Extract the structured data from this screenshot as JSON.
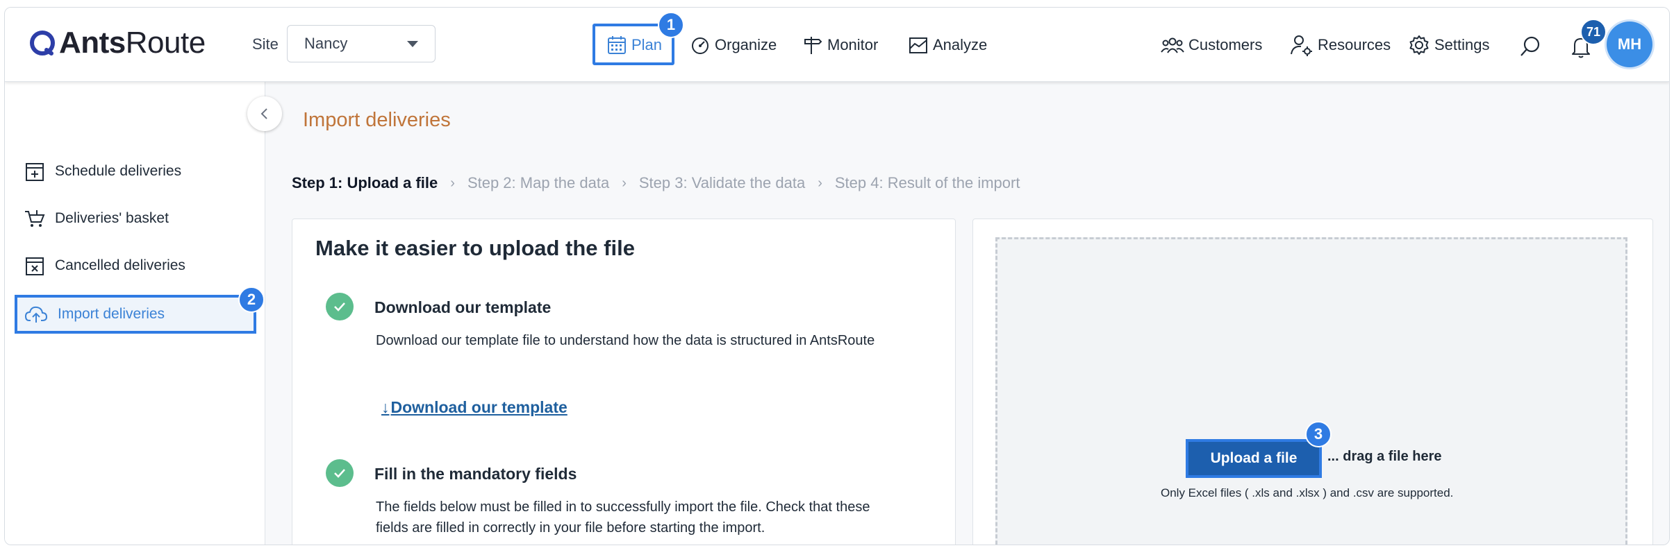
{
  "brand": {
    "name_bold": "Ants",
    "name_regular": "Route"
  },
  "site": {
    "label": "Site",
    "value": "Nancy"
  },
  "nav": {
    "plan": "Plan",
    "organize": "Organize",
    "monitor": "Monitor",
    "analyze": "Analyze",
    "customers": "Customers",
    "resources": "Resources",
    "settings": "Settings"
  },
  "notifications": {
    "count": "71"
  },
  "user": {
    "initials": "MH"
  },
  "step_badges": {
    "one": "1",
    "two": "2",
    "three": "3"
  },
  "sidebar": {
    "items": [
      {
        "label": "Schedule deliveries",
        "icon": "calendar-plus-icon"
      },
      {
        "label": "Deliveries' basket",
        "icon": "basket-icon"
      },
      {
        "label": "Cancelled deliveries",
        "icon": "calendar-x-icon"
      },
      {
        "label": "Import deliveries",
        "icon": "cloud-upload-icon"
      }
    ]
  },
  "page": {
    "title": "Import deliveries"
  },
  "steps": [
    {
      "label": "Step 1: Upload a file"
    },
    {
      "label": "Step 2: Map the data"
    },
    {
      "label": "Step 3: Validate the data"
    },
    {
      "label": "Step 4: Result of the import"
    }
  ],
  "help_card": {
    "title": "Make it easier to upload the file",
    "section1_title": "Download our template",
    "section1_text": "Download our template file to understand how the data is structured in AntsRoute",
    "download_arrow": "↓",
    "download_link": "Download our template",
    "section2_title": "Fill in the mandatory fields",
    "section2_text": "The fields below must be filled in to successfully import the file. Check that these fields are filled in correctly in your file before starting the import."
  },
  "upload": {
    "button": "Upload a file",
    "drag_text": "... drag a file here",
    "support_text": "Only Excel files ( .xls and .xlsx ) and .csv are supported."
  },
  "colors": {
    "accent": "#2f7be3",
    "primary_button": "#1d5fae",
    "title_orange": "#c0753a",
    "check_green": "#5cbd8d"
  }
}
